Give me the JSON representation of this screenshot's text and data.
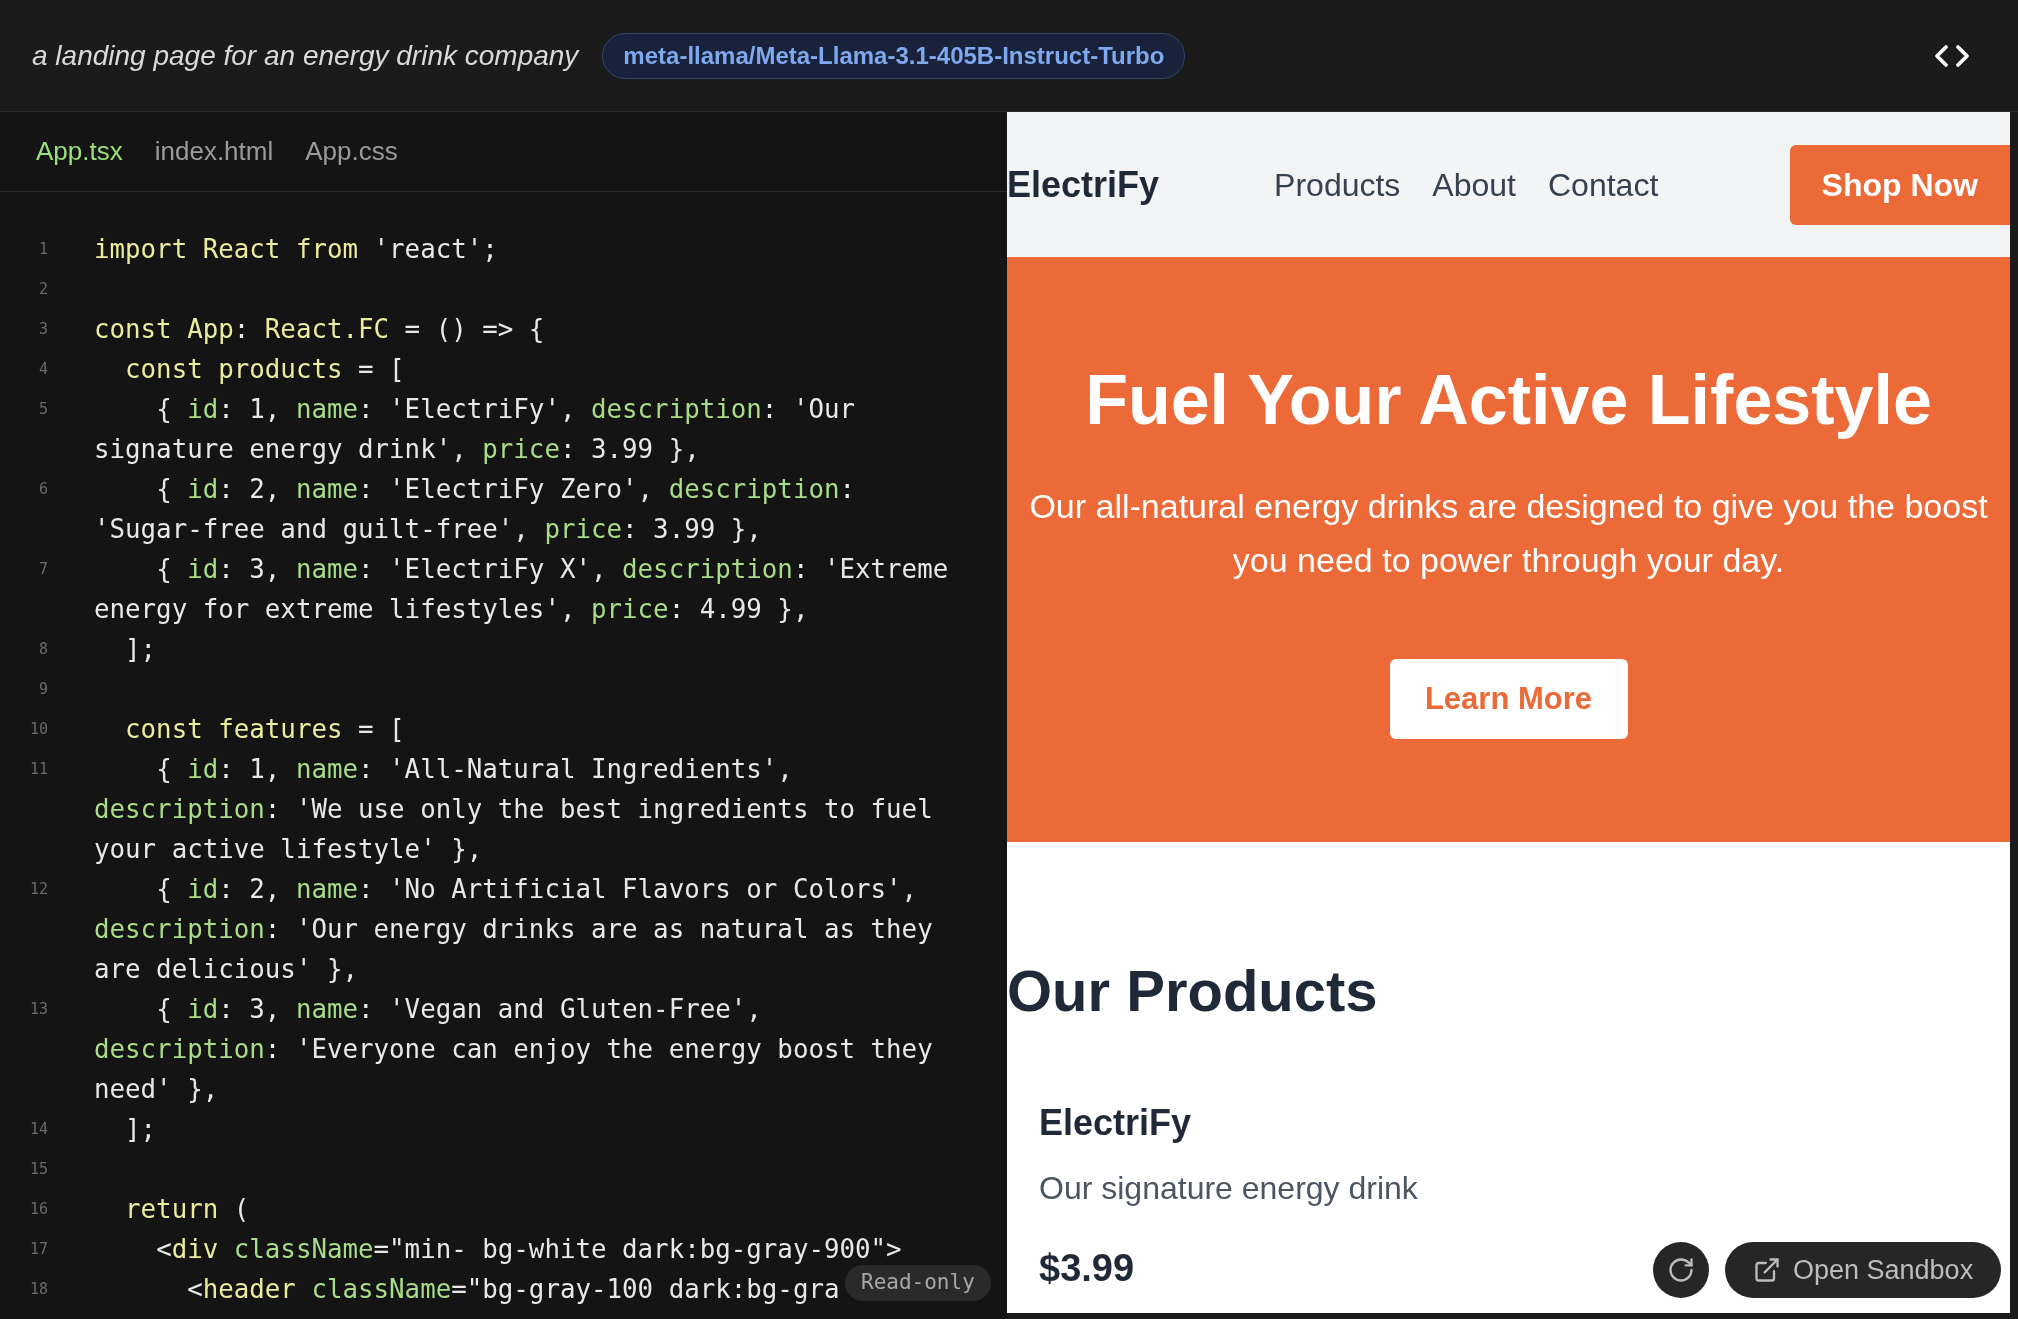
{
  "header": {
    "prompt": "a landing page for an energy drink company",
    "model": "meta-llama/Meta-Llama-3.1-405B-Instruct-Turbo"
  },
  "editor": {
    "tabs": [
      {
        "label": "App.tsx",
        "selected": true
      },
      {
        "label": "index.html",
        "selected": false
      },
      {
        "label": "App.css",
        "selected": false
      }
    ],
    "lines": [
      {
        "number": "1",
        "tokens": [
          {
            "kind": "kw",
            "text": "import React from "
          },
          {
            "kind": "plain",
            "text": "'react';"
          }
        ]
      },
      {
        "number": "2"
      },
      {
        "number": "3",
        "tokens": [
          {
            "kind": "kw",
            "text": "const App"
          },
          {
            "kind": "plain",
            "text": ": "
          },
          {
            "kind": "kw",
            "text": "React.FC"
          },
          {
            "kind": "plain",
            "text": " = () => {"
          }
        ]
      },
      {
        "number": "4",
        "tokens": [
          {
            "kind": "kw",
            "text": "  const products"
          },
          {
            "kind": "plain",
            "text": " = ["
          }
        ]
      },
      {
        "number": "5",
        "tokens": [
          {
            "kind": "plain",
            "text": "    { "
          },
          {
            "kind": "prop",
            "text": "id"
          },
          {
            "kind": "plain",
            "text": ": 1, "
          },
          {
            "kind": "prop",
            "text": "name"
          },
          {
            "kind": "plain",
            "text": ": 'ElectriFy', "
          },
          {
            "kind": "prop",
            "text": "description"
          },
          {
            "kind": "plain",
            "text": ": 'Our signature energy drink', "
          },
          {
            "kind": "prop",
            "text": "price"
          },
          {
            "kind": "plain",
            "text": ": 3.99 },"
          }
        ]
      },
      {
        "number": "6",
        "tokens": [
          {
            "kind": "plain",
            "text": "    { "
          },
          {
            "kind": "prop",
            "text": "id"
          },
          {
            "kind": "plain",
            "text": ": 2, "
          },
          {
            "kind": "prop",
            "text": "name"
          },
          {
            "kind": "plain",
            "text": ": 'ElectriFy Zero', "
          },
          {
            "kind": "prop",
            "text": "description"
          },
          {
            "kind": "plain",
            "text": ": 'Sugar-free and guilt-free', "
          },
          {
            "kind": "prop",
            "text": "price"
          },
          {
            "kind": "plain",
            "text": ": 3.99 },"
          }
        ]
      },
      {
        "number": "7",
        "tokens": [
          {
            "kind": "plain",
            "text": "    { "
          },
          {
            "kind": "prop",
            "text": "id"
          },
          {
            "kind": "plain",
            "text": ": 3, "
          },
          {
            "kind": "prop",
            "text": "name"
          },
          {
            "kind": "plain",
            "text": ": 'ElectriFy X', "
          },
          {
            "kind": "prop",
            "text": "description"
          },
          {
            "kind": "plain",
            "text": ": 'Extreme energy for extreme lifestyles', "
          },
          {
            "kind": "prop",
            "text": "price"
          },
          {
            "kind": "plain",
            "text": ": 4.99 },"
          }
        ]
      },
      {
        "number": "8",
        "tokens": [
          {
            "kind": "plain",
            "text": "  ];"
          }
        ]
      },
      {
        "number": "9"
      },
      {
        "number": "10",
        "tokens": [
          {
            "kind": "kw",
            "text": "  const features"
          },
          {
            "kind": "plain",
            "text": " = ["
          }
        ]
      },
      {
        "number": "11",
        "tokens": [
          {
            "kind": "plain",
            "text": "    { "
          },
          {
            "kind": "prop",
            "text": "id"
          },
          {
            "kind": "plain",
            "text": ": 1, "
          },
          {
            "kind": "prop",
            "text": "name"
          },
          {
            "kind": "plain",
            "text": ": 'All-Natural Ingredients', "
          },
          {
            "kind": "prop",
            "text": "description"
          },
          {
            "kind": "plain",
            "text": ": 'We use only the best ingredients to fuel your active lifestyle' },"
          }
        ]
      },
      {
        "number": "12",
        "tokens": [
          {
            "kind": "plain",
            "text": "    { "
          },
          {
            "kind": "prop",
            "text": "id"
          },
          {
            "kind": "plain",
            "text": ": 2, "
          },
          {
            "kind": "prop",
            "text": "name"
          },
          {
            "kind": "plain",
            "text": ": 'No Artificial Flavors or Colors', "
          },
          {
            "kind": "prop",
            "text": "description"
          },
          {
            "kind": "plain",
            "text": ": 'Our energy drinks are as natural as they are delicious' },"
          }
        ]
      },
      {
        "number": "13",
        "tokens": [
          {
            "kind": "plain",
            "text": "    { "
          },
          {
            "kind": "prop",
            "text": "id"
          },
          {
            "kind": "plain",
            "text": ": 3, "
          },
          {
            "kind": "prop",
            "text": "name"
          },
          {
            "kind": "plain",
            "text": ": 'Vegan and Gluten-Free', "
          },
          {
            "kind": "prop",
            "text": "description"
          },
          {
            "kind": "plain",
            "text": ": 'Everyone can enjoy the energy boost they need' },"
          }
        ]
      },
      {
        "number": "14",
        "tokens": [
          {
            "kind": "plain",
            "text": "  ];"
          }
        ]
      },
      {
        "number": "15"
      },
      {
        "number": "16",
        "tokens": [
          {
            "kind": "kw",
            "text": "  return"
          },
          {
            "kind": "plain",
            "text": " ("
          }
        ]
      },
      {
        "number": "17",
        "tokens": [
          {
            "kind": "plain",
            "text": "    <"
          },
          {
            "kind": "kw",
            "text": "div "
          },
          {
            "kind": "prop",
            "text": "className"
          },
          {
            "kind": "plain",
            "text": "=\"min- bg-white dark:bg-gray-900\">"
          }
        ]
      },
      {
        "number": "18",
        "tokens": [
          {
            "kind": "plain",
            "text": "      <"
          },
          {
            "kind": "kw",
            "text": "header "
          },
          {
            "kind": "prop",
            "text": "className"
          },
          {
            "kind": "plain",
            "text": "=\"bg-gray-100 dark:bg-gra"
          }
        ]
      }
    ],
    "badge": "Read-only"
  },
  "preview": {
    "nav": {
      "logo": "ElectriFy",
      "links": [
        "Products",
        "About",
        "Contact"
      ],
      "cta": "Shop Now"
    },
    "hero": {
      "title": "Fuel Your Active Lifestyle",
      "text": "Our all-natural energy drinks are designed to give you the boost you need to power through your day.",
      "button": "Learn More"
    },
    "products": {
      "title": "Our Products",
      "items": [
        {
          "name": "ElectriFy",
          "description": "Our signature energy drink",
          "price": "$3.99"
        }
      ]
    },
    "open_sandbox": "Open Sandbox"
  }
}
